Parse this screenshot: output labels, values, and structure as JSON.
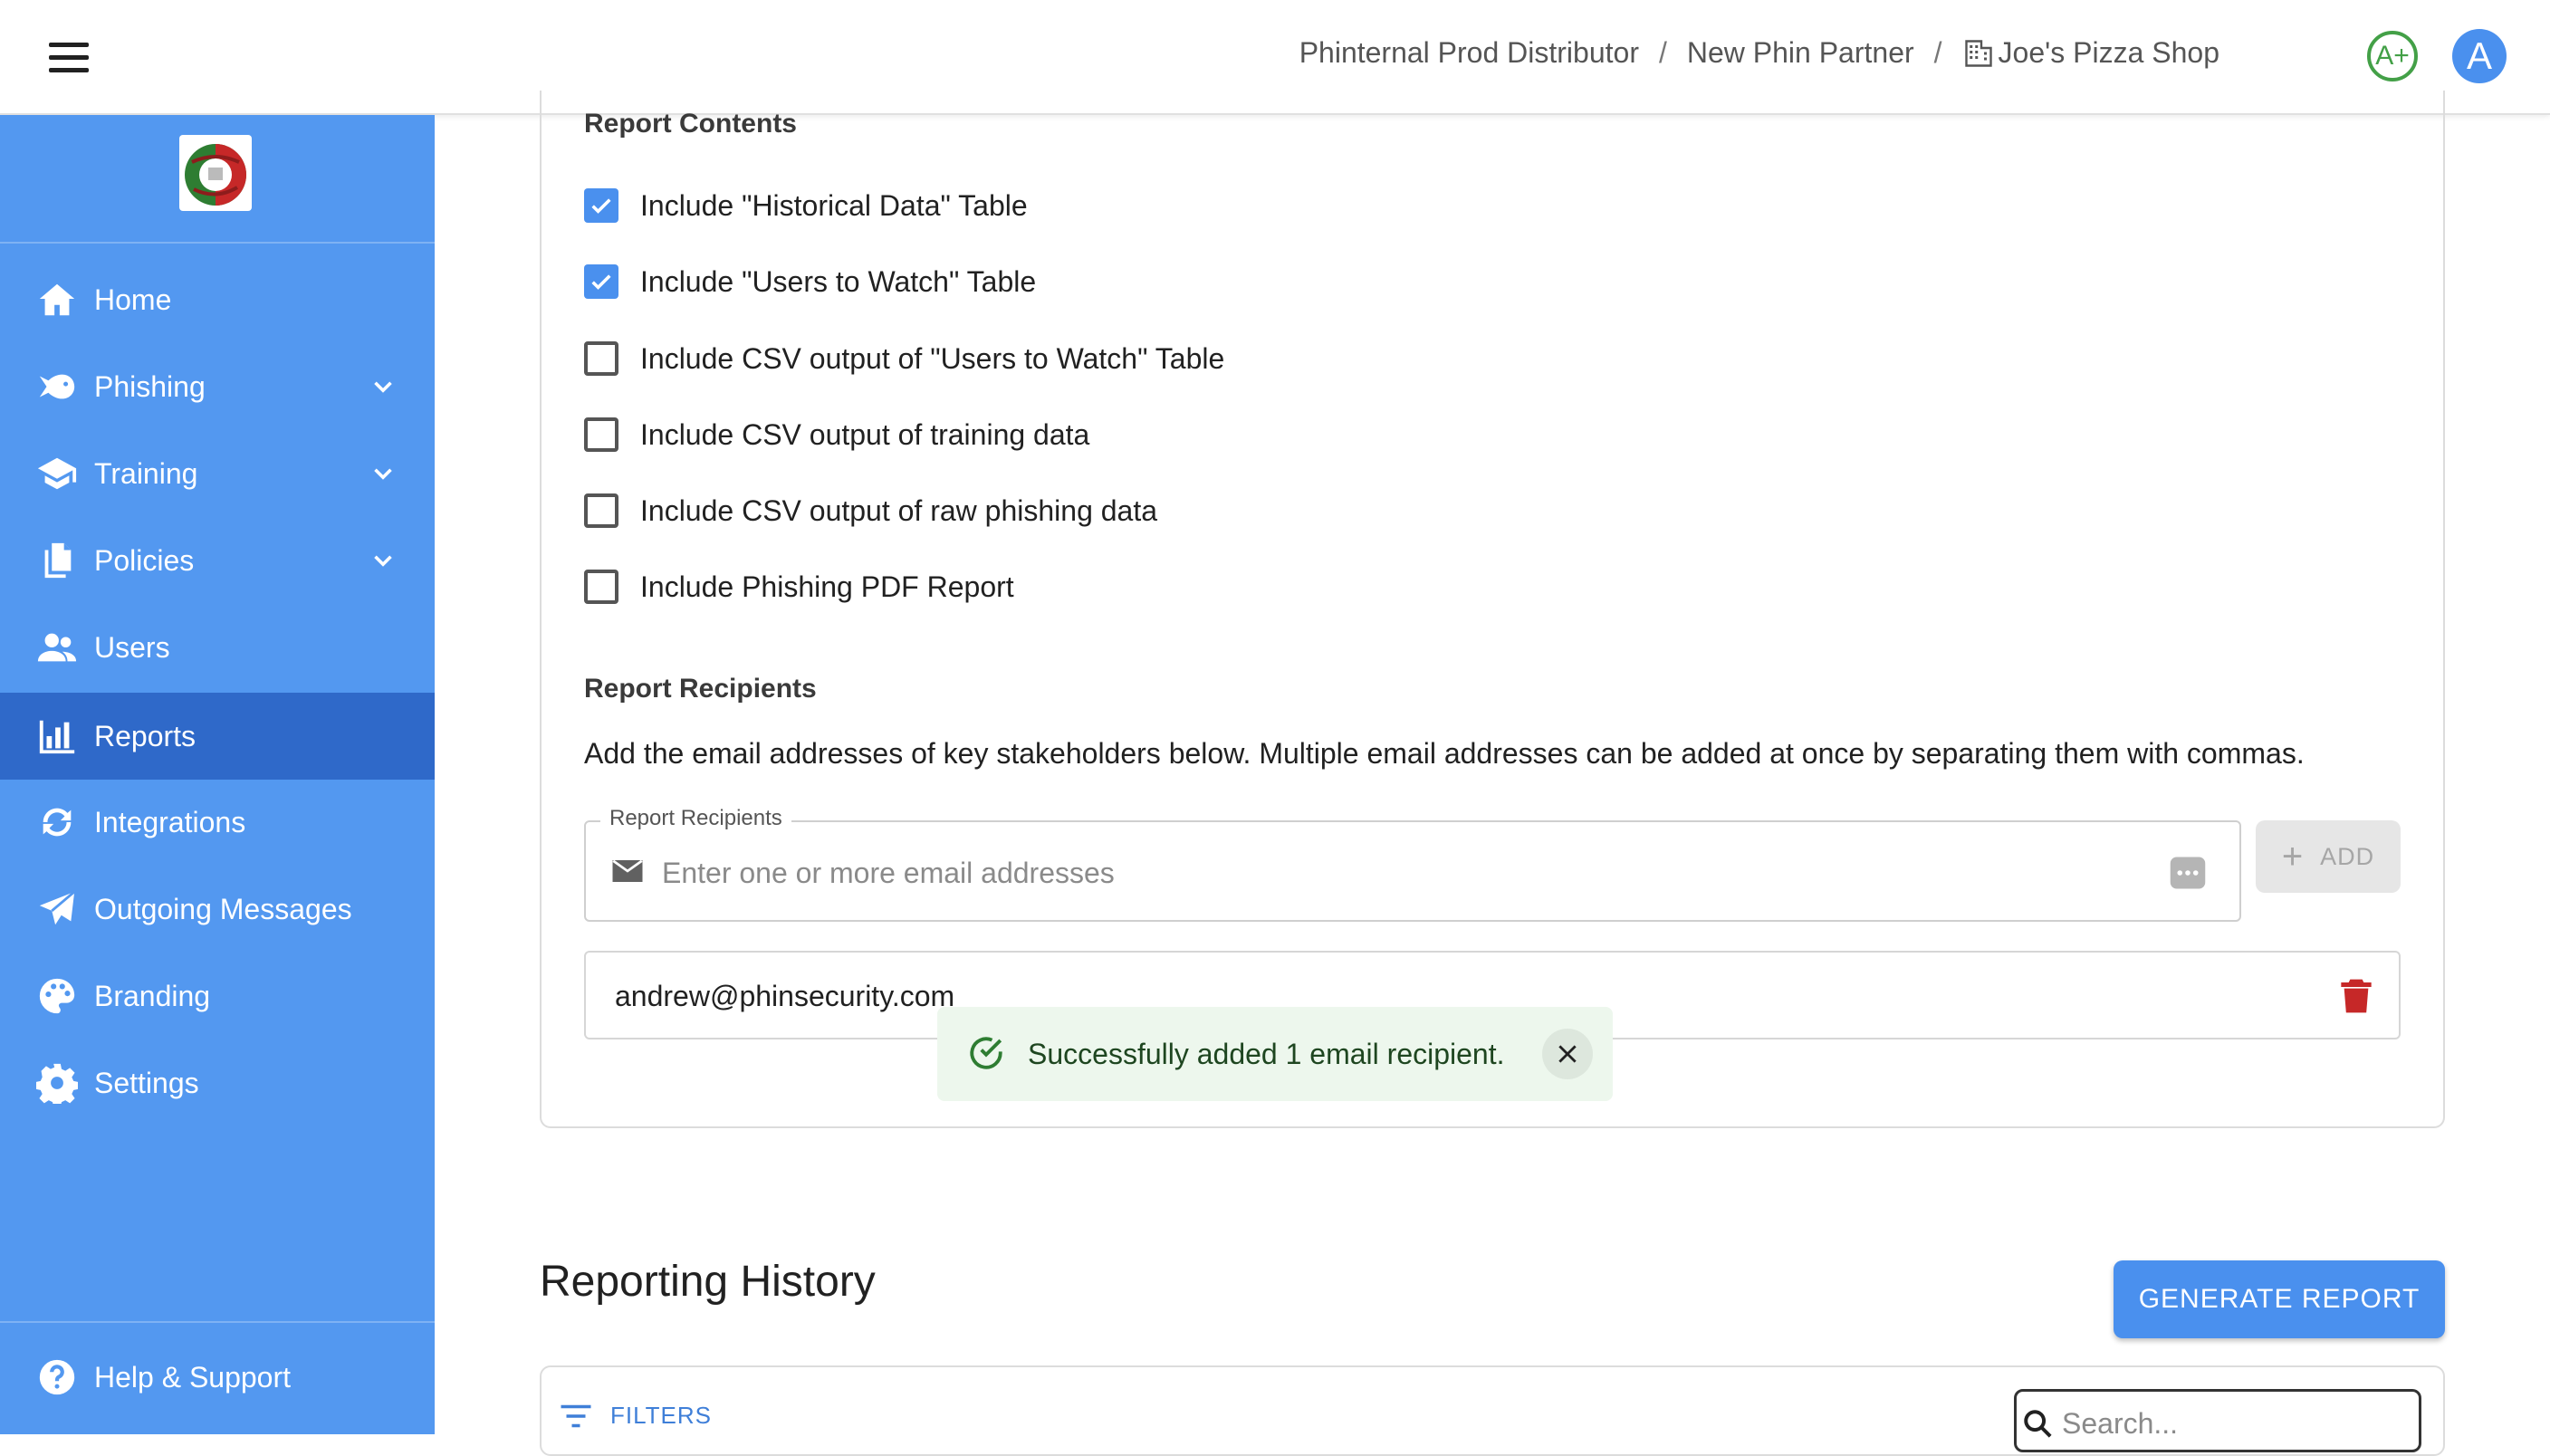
{
  "header": {
    "breadcrumb": [
      "Phinternal Prod Distributor",
      "New Phin Partner",
      "Joe's Pizza Shop"
    ],
    "breadcrumb_separator": "/",
    "grade": "A+",
    "avatar_initial": "A"
  },
  "sidebar": {
    "logo_alt": "Joe's Pizza",
    "items": [
      {
        "label": "Home",
        "icon": "home-icon",
        "expandable": false,
        "active": false
      },
      {
        "label": "Phishing",
        "icon": "fish-icon",
        "expandable": true,
        "active": false
      },
      {
        "label": "Training",
        "icon": "graduation-cap-icon",
        "expandable": true,
        "active": false
      },
      {
        "label": "Policies",
        "icon": "documents-icon",
        "expandable": true,
        "active": false
      },
      {
        "label": "Users",
        "icon": "users-icon",
        "expandable": false,
        "active": false
      },
      {
        "label": "Reports",
        "icon": "bar-chart-icon",
        "expandable": false,
        "active": true
      },
      {
        "label": "Integrations",
        "icon": "sync-icon",
        "expandable": false,
        "active": false
      },
      {
        "label": "Outgoing Messages",
        "icon": "paper-plane-icon",
        "expandable": false,
        "active": false
      },
      {
        "label": "Branding",
        "icon": "palette-icon",
        "expandable": false,
        "active": false
      },
      {
        "label": "Settings",
        "icon": "gear-icon",
        "expandable": false,
        "active": false
      }
    ],
    "help": {
      "label": "Help & Support",
      "icon": "help-icon"
    }
  },
  "report_contents": {
    "title": "Report Contents",
    "options": [
      {
        "label": "Include \"Historical Data\" Table",
        "checked": true
      },
      {
        "label": "Include \"Users to Watch\" Table",
        "checked": true
      },
      {
        "label": "Include CSV output of \"Users to Watch\" Table",
        "checked": false
      },
      {
        "label": "Include CSV output of training data",
        "checked": false
      },
      {
        "label": "Include CSV output of raw phishing data",
        "checked": false
      },
      {
        "label": "Include Phishing PDF Report",
        "checked": false
      }
    ]
  },
  "recipients": {
    "title": "Report Recipients",
    "help": "Add the email addresses of key stakeholders below. Multiple email addresses can be added at once by separating them with commas.",
    "field_label": "Report Recipients",
    "placeholder": "Enter one or more email addresses",
    "value": "",
    "add_label": "ADD",
    "list": [
      "andrew@phinsecurity.com"
    ]
  },
  "toast": {
    "message": "Successfully added 1 email recipient."
  },
  "history": {
    "title": "Reporting History",
    "generate_label": "GENERATE REPORT",
    "filters_label": "FILTERS",
    "search_placeholder": "Search..."
  },
  "colors": {
    "sidebar": "#5398f0",
    "sidebar_active": "#2f69c9",
    "accent": "#4a90ee",
    "grade": "#43a047",
    "toast_bg": "#edf7ed",
    "delete": "#c62828"
  }
}
